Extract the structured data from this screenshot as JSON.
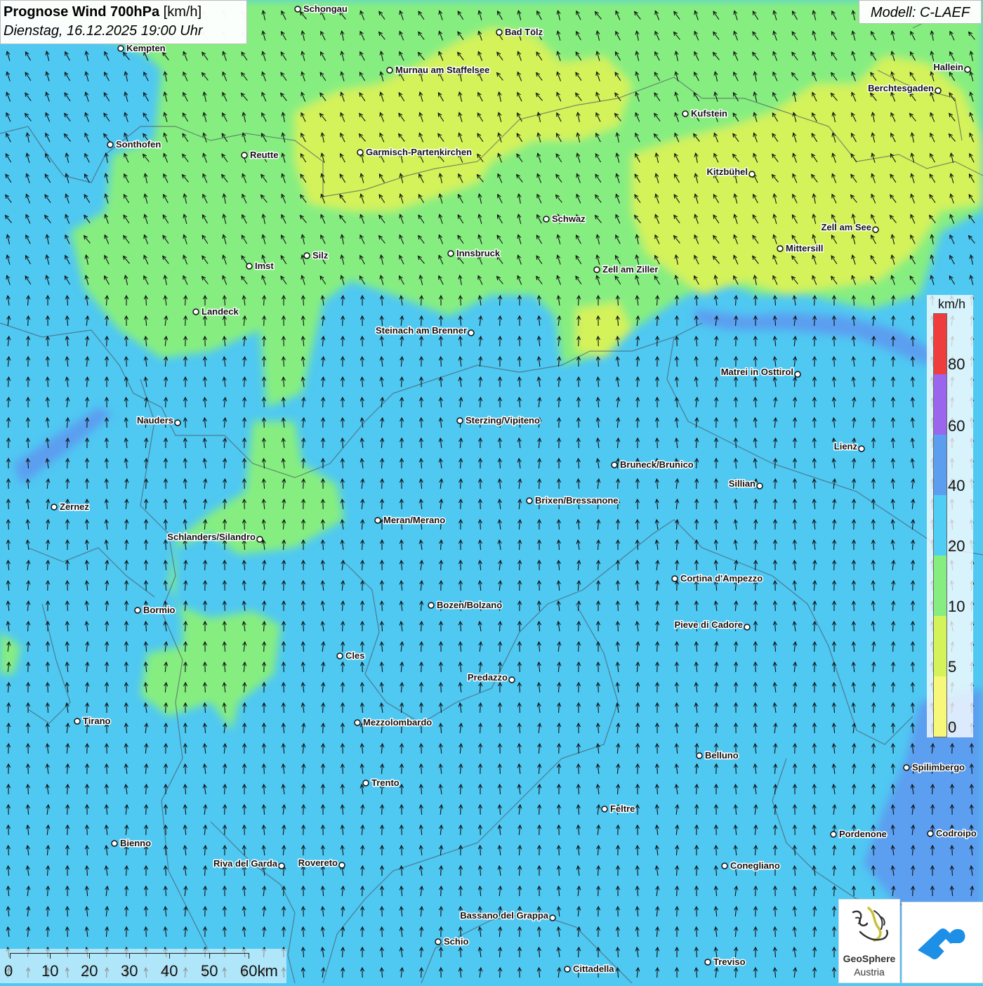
{
  "header": {
    "title_bold": "Prognose Wind 700hPa",
    "title_unit": "[km/h]",
    "datetime": "Dienstag, 16.12.2025 19:00 Uhr",
    "model": "Modell: C-LAEF"
  },
  "legend": {
    "unit": "km/h",
    "labels": [
      "80",
      "60",
      "40",
      "20",
      "10",
      "5",
      "0"
    ],
    "colors": [
      "#f7f779",
      "#d4f25a",
      "#86ee80",
      "#4fcdf5",
      "#5b9ef0",
      "#9a66ee",
      "#ef3d3d"
    ]
  },
  "scale_bar": {
    "labels": [
      "0",
      "10",
      "20",
      "30",
      "40",
      "50",
      "60km"
    ]
  },
  "logos": {
    "geosphere_name": "GeoSphere",
    "geosphere_sub": "Austria"
  },
  "cities": [
    {
      "name": "Schongau"
    },
    {
      "name": "Bad Tölz"
    },
    {
      "name": "Kempten"
    },
    {
      "name": "Murnau am Staffelsee"
    },
    {
      "name": "Hallein"
    },
    {
      "name": "Berchtesgaden"
    },
    {
      "name": "Kufstein"
    },
    {
      "name": "Sonthofen"
    },
    {
      "name": "Reutte"
    },
    {
      "name": "Garmisch-Partenkirchen"
    },
    {
      "name": "Kitzbühel"
    },
    {
      "name": "Schwaz"
    },
    {
      "name": "Zell am See"
    },
    {
      "name": "Innsbruck"
    },
    {
      "name": "Mittersill"
    },
    {
      "name": "Silz"
    },
    {
      "name": "Imst"
    },
    {
      "name": "Zell am Ziller"
    },
    {
      "name": "Landeck"
    },
    {
      "name": "Steinach am Brenner"
    },
    {
      "name": "Matrei in Osttirol"
    },
    {
      "name": "Nauders"
    },
    {
      "name": "Sterzing/Vipiteno"
    },
    {
      "name": "Lienz"
    },
    {
      "name": "Bruneck/Brunico"
    },
    {
      "name": "Sillian"
    },
    {
      "name": "Zernez"
    },
    {
      "name": "Brixen/Bressanone"
    },
    {
      "name": "Meran/Merano"
    },
    {
      "name": "Schlanders/Silandro"
    },
    {
      "name": "Cortina d'Ampezzo"
    },
    {
      "name": "Bormio"
    },
    {
      "name": "Bozen/Bolzano"
    },
    {
      "name": "Pieve di Cadore"
    },
    {
      "name": "Cles"
    },
    {
      "name": "Predazzo"
    },
    {
      "name": "Tirano"
    },
    {
      "name": "Mezzolombardo"
    },
    {
      "name": "Belluno"
    },
    {
      "name": "Spilimbergo"
    },
    {
      "name": "Trento"
    },
    {
      "name": "Feltre"
    },
    {
      "name": "Bienno"
    },
    {
      "name": "Pordenone"
    },
    {
      "name": "Codroipo"
    },
    {
      "name": "Riva del Garda"
    },
    {
      "name": "Rovereto"
    },
    {
      "name": "Conegliano"
    },
    {
      "name": "Bassano del Grappa"
    },
    {
      "name": "Schio"
    },
    {
      "name": "Treviso"
    },
    {
      "name": "Cittadella"
    }
  ]
}
